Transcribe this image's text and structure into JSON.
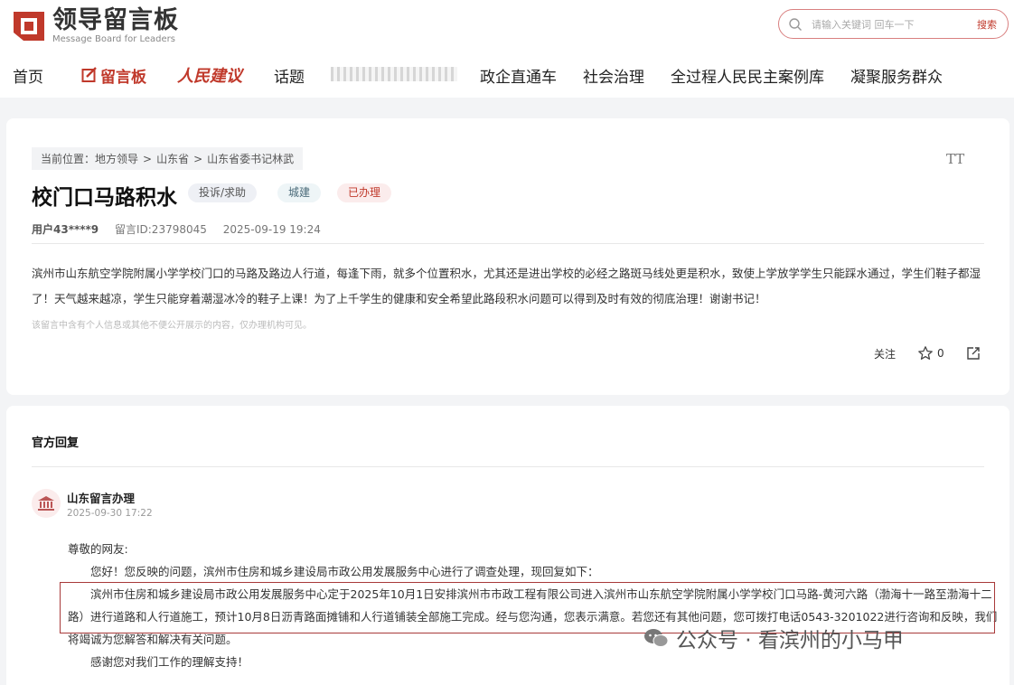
{
  "brand": {
    "name_cn": "领导留言板",
    "name_en": "Message Board for Leaders",
    "color": "#c0392b"
  },
  "search": {
    "placeholder": "请输入关键词 回车一下",
    "button": "搜索"
  },
  "nav": {
    "home": "首页",
    "message_board": "留言板",
    "people_suggest": "人民建议",
    "topics": "话题",
    "gov_business": "政企直通车",
    "social_gov": "社会治理",
    "whole_process": "全过程人民民主案例库",
    "serve_masses": "凝聚服务群众"
  },
  "post": {
    "breadcrumb": {
      "label": "当前位置：",
      "items": [
        "地方领导",
        "山东省",
        "山东省委书记林武"
      ],
      "sep": ">"
    },
    "font_toggle": "TT",
    "title": "校门口马路积水",
    "tags": [
      "投诉/求助",
      "城建",
      "已办理"
    ],
    "user": "用户43****9",
    "msg_id": "留言ID:23798045",
    "time": "2025-09-19 19:24",
    "content": "滨州市山东航空学院附属小学学校门口的马路及路边人行道，每逢下雨，就多个位置积水，尤其还是进出学校的必经之路斑马线处更是积水，致使上学放学学生只能踩水通过，学生们鞋子都湿了！天气越来越凉，学生只能穿着潮湿冰冷的鞋子上课！为了上千学生的健康和安全希望此路段积水问题可以得到及时有效的彻底治理！谢谢书记！",
    "notice": "该留言中含有个人信息或其他不便公开展示的内容，仅办理机构可见。",
    "follow": "关注",
    "likes": "0"
  },
  "reply": {
    "section_title": "官方回复",
    "org": "山东留言办理",
    "time": "2025-09-30 17:22",
    "greeting": "尊敬的网友:",
    "p1": "您好！您反映的问题，滨州市住房和城乡建设局市政公用发展服务中心进行了调查处理，现回复如下：",
    "p2": "滨州市住房和城乡建设局市政公用发展服务中心定于2025年10月1日安排滨州市市政工程有限公司进入滨州市山东航空学院附属小学学校门口马路-黄河六路（渤海十一路至渤海十二路）进行道路和人行道施工，预计10月8日沥青路面摊铺和人行道铺装全部施工完成。经与您沟通，您表示满意。若您还有其他问题，您可拨打电话0543-3201022进行咨询和反映，我们将竭诚为您解答和解决有关问题。",
    "p3": "感谢您对我们工作的理解支持！"
  },
  "watermark": "公众号 · 看滨州的小马甲"
}
